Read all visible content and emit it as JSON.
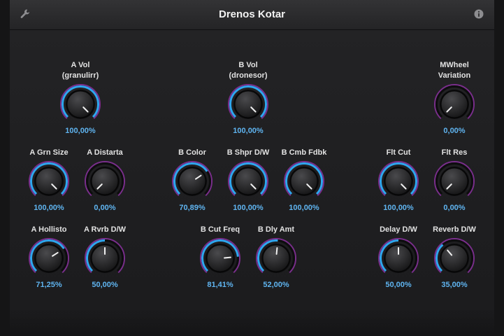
{
  "window": {
    "title": "Drenos Kotar"
  },
  "icons": {
    "settings": "wrench-icon",
    "info": "info-icon"
  },
  "colors": {
    "value_text": "#5fb4f0",
    "arc_value": "#2fa6ee",
    "arc_ring": "#7a2e8c",
    "label_text": "#e2e2e2"
  },
  "knobs": [
    {
      "id": "a-vol",
      "line1": "A Vol",
      "line2": "(granulirr)",
      "value": "100,00%",
      "fraction": 1.0
    },
    {
      "id": "b-vol",
      "line1": "B Vol",
      "line2": "(dronesor)",
      "value": "100,00%",
      "fraction": 1.0
    },
    {
      "id": "mwheel-variation",
      "line1": "MWheel",
      "line2": "Variation",
      "value": "0,00%",
      "fraction": 0.0
    },
    {
      "id": "a-grn-size",
      "line1": "A Grn Size",
      "line2": "",
      "value": "100,00%",
      "fraction": 1.0
    },
    {
      "id": "a-distarta",
      "line1": "A Distarta",
      "line2": "",
      "value": "0,00%",
      "fraction": 0.0
    },
    {
      "id": "b-color",
      "line1": "B Color",
      "line2": "",
      "value": "70,89%",
      "fraction": 0.7089
    },
    {
      "id": "b-shpr-dw",
      "line1": "B Shpr D/W",
      "line2": "",
      "value": "100,00%",
      "fraction": 1.0
    },
    {
      "id": "b-cmb-fdbk",
      "line1": "B Cmb Fdbk",
      "line2": "",
      "value": "100,00%",
      "fraction": 1.0
    },
    {
      "id": "flt-cut",
      "line1": "Flt Cut",
      "line2": "",
      "value": "100,00%",
      "fraction": 1.0
    },
    {
      "id": "flt-res",
      "line1": "Flt Res",
      "line2": "",
      "value": "0,00%",
      "fraction": 0.0
    },
    {
      "id": "a-hollisto",
      "line1": "A Hollisto",
      "line2": "",
      "value": "71,25%",
      "fraction": 0.7125
    },
    {
      "id": "a-rvrb-dw",
      "line1": "A Rvrb D/W",
      "line2": "",
      "value": "50,00%",
      "fraction": 0.5
    },
    {
      "id": "b-cut-freq",
      "line1": "B Cut Freq",
      "line2": "",
      "value": "81,41%",
      "fraction": 0.8141
    },
    {
      "id": "b-dly-amt",
      "line1": "B Dly Amt",
      "line2": "",
      "value": "52,00%",
      "fraction": 0.52
    },
    {
      "id": "delay-dw",
      "line1": "Delay D/W",
      "line2": "",
      "value": "50,00%",
      "fraction": 0.5
    },
    {
      "id": "reverb-dw",
      "line1": "Reverb D/W",
      "line2": "",
      "value": "35,00%",
      "fraction": 0.35
    }
  ]
}
